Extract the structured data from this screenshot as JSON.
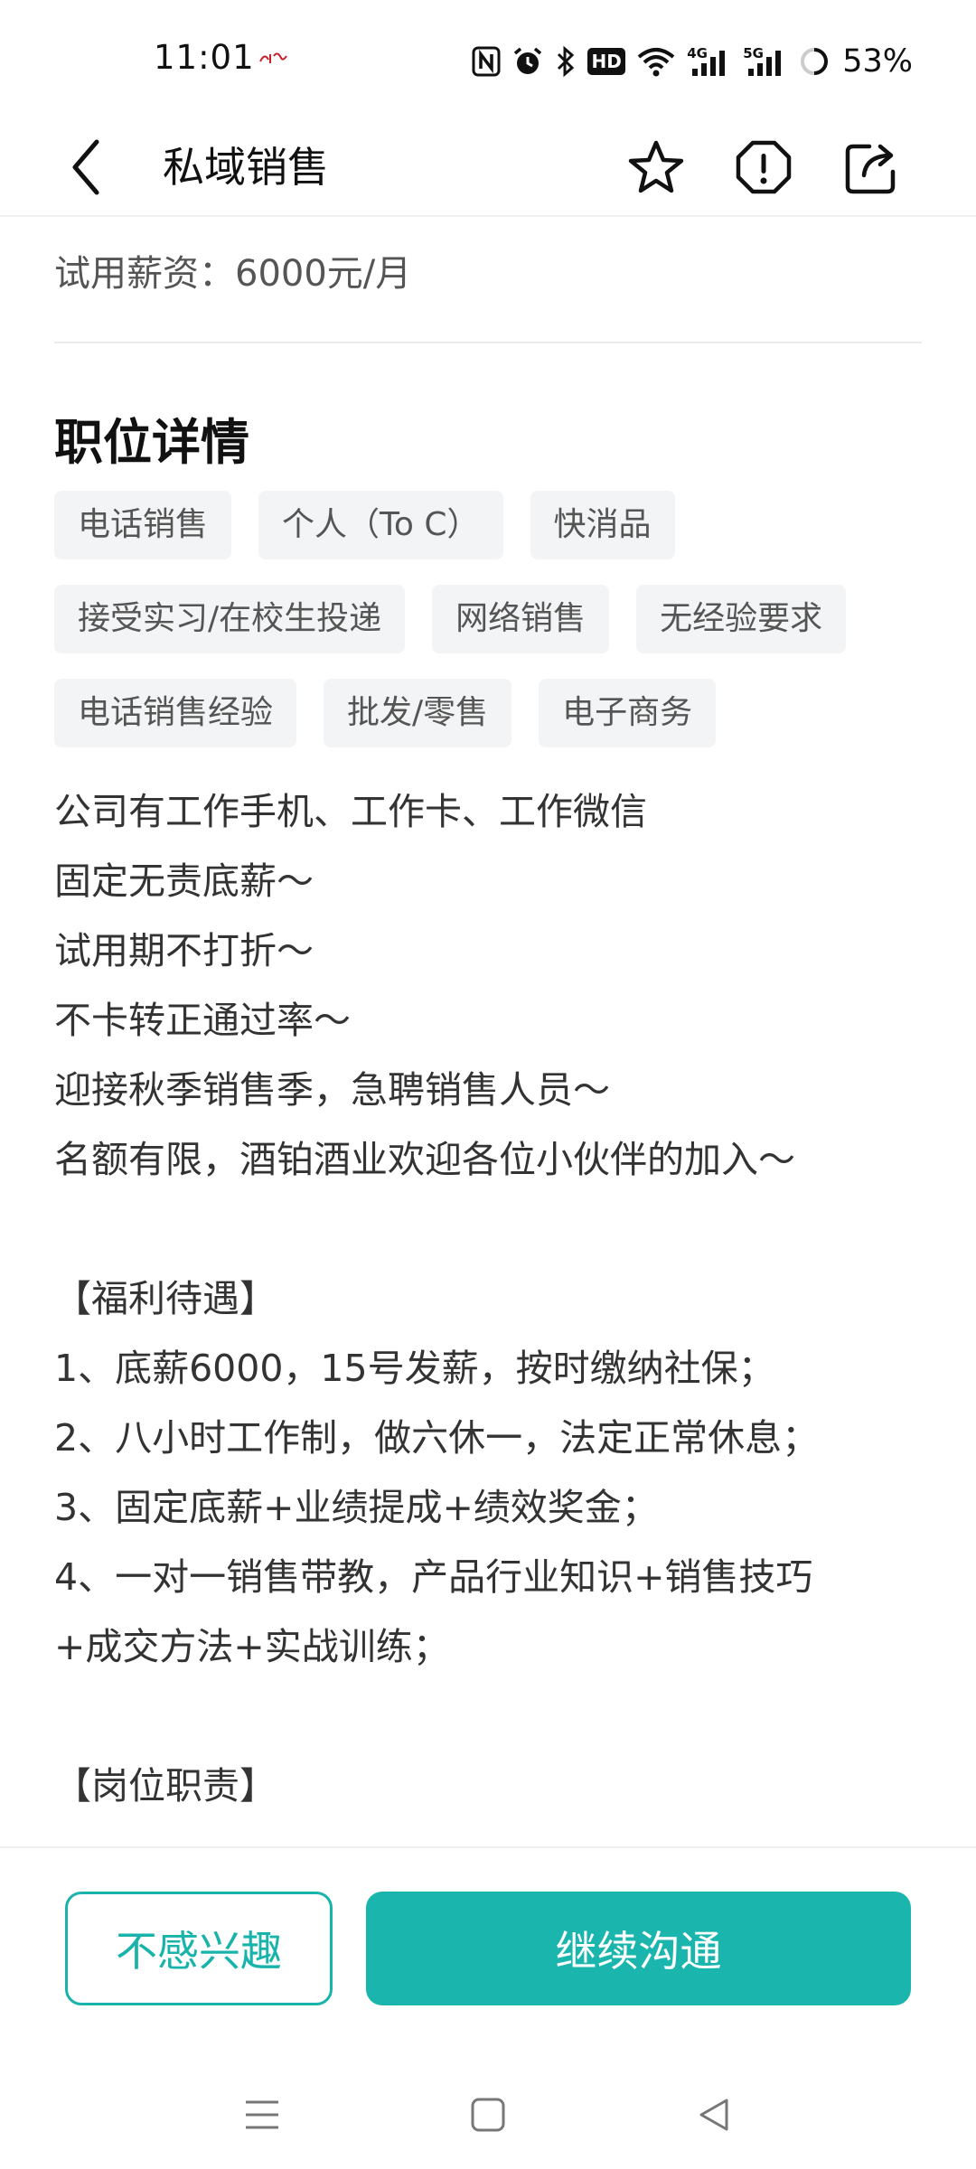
{
  "status_bar": {
    "time": "11:01",
    "app_logo_icon": "people-daily-logo",
    "icons": [
      "nfc-icon",
      "alarm-icon",
      "bluetooth-icon",
      "hd-voice-icon",
      "wifi-icon",
      "signal-4g-icon",
      "signal-5g-icon",
      "battery-icon"
    ],
    "signal_4g_label": "4G",
    "signal_5g_label": "5G",
    "hd_label": "HD",
    "battery_percent": "53%"
  },
  "app_bar": {
    "title": "私域销售",
    "back_icon": "chevron-left-icon",
    "actions": [
      "star-icon",
      "report-icon",
      "share-icon"
    ]
  },
  "job": {
    "salary_line": "试用薪资：6000元/月",
    "section_title": "职位详情",
    "tag_rows": [
      [
        "电话销售",
        "个人（To C）",
        "快消品"
      ],
      [
        "接受实习/在校生投递",
        "网络销售",
        "无经验要求"
      ],
      [
        "电话销售经验",
        "批发/零售",
        "电子商务"
      ]
    ],
    "description_lines": [
      "公司有工作手机、工作卡、工作微信",
      "固定无责底薪～",
      "试用期不打折～",
      "不卡转正通过率～",
      "迎接秋季销售季，急聘销售人员～",
      "名额有限，酒铂酒业欢迎各位小伙伴的加入～",
      "",
      "【福利待遇】",
      "1、底薪6000，15号发薪，按时缴纳社保；",
      "2、八小时工作制，做六休一，法定正常休息；",
      "3、固定底薪+业绩提成+绩效奖金；",
      "4、一对一销售带教，产品行业知识+销售技巧",
      "+成交方法+实战训练；",
      "",
      "【岗位职责】"
    ]
  },
  "bottom_bar": {
    "not_interested_label": "不感兴趣",
    "continue_label": "继续沟通",
    "accent_color": "#1ab6ae"
  },
  "system_nav": {
    "buttons": [
      "menu-icon",
      "home-icon",
      "back-triangle-icon"
    ]
  }
}
